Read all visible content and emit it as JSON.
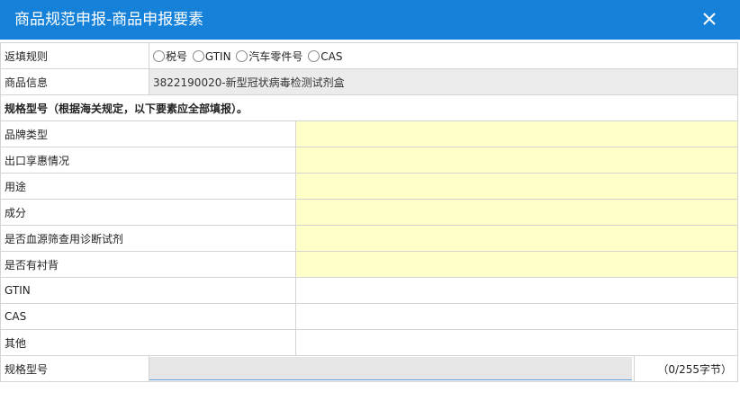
{
  "window": {
    "title": "商品规范申报-商品申报要素",
    "close_icon": "close-icon"
  },
  "fill_rule": {
    "label": "返填规则",
    "options": [
      "税号",
      "GTIN",
      "汽车零件号",
      "CAS"
    ]
  },
  "product_info": {
    "label": "商品信息",
    "value": "3822190020-新型冠状病毒检测试剂盒"
  },
  "section_note": "规格型号（根据海关规定，以下要素应全部填报）。",
  "elements": [
    {
      "label": "品牌类型",
      "value": ""
    },
    {
      "label": "出口享惠情况",
      "value": ""
    },
    {
      "label": "用途",
      "value": ""
    },
    {
      "label": "成分",
      "value": ""
    },
    {
      "label": "是否血源筛查用诊断试剂",
      "value": ""
    },
    {
      "label": "是否有衬背",
      "value": ""
    },
    {
      "label": "GTIN",
      "value": ""
    },
    {
      "label": "CAS",
      "value": ""
    },
    {
      "label": "其他",
      "value": ""
    }
  ],
  "spec_model": {
    "label": "规格型号",
    "value": "",
    "counter": "（0/255字节）"
  },
  "colors": {
    "titlebar": "#1681d9",
    "required_field": "#ffffc8",
    "readonly_field": "#ebebeb"
  }
}
